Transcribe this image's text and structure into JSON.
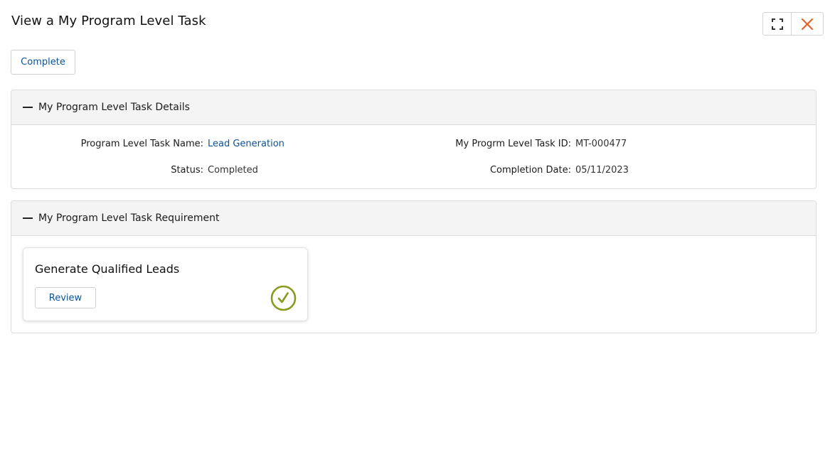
{
  "window": {
    "title": "View a My Program Level Task",
    "expand_icon": "expand-icon",
    "close_icon": "close-icon",
    "close_color": "#e8632b"
  },
  "toolbar": {
    "complete_label": "Complete"
  },
  "details_panel": {
    "title": "My Program Level Task Details",
    "fields": {
      "task_name_label": "Program Level Task Name:",
      "task_name_value": "Lead Generation",
      "task_id_label": "My Progrm Level Task ID:",
      "task_id_value": "MT-000477",
      "status_label": "Status:",
      "status_value": "Completed",
      "completion_date_label": "Completion Date:",
      "completion_date_value": "05/11/2023"
    }
  },
  "requirement_panel": {
    "title": "My Program Level Task Requirement",
    "card": {
      "title": "Generate Qualified Leads",
      "review_label": "Review",
      "status_icon": "check-circle-icon",
      "status_color": "#8a9a1e"
    }
  },
  "colors": {
    "link": "#0b5394",
    "panel_header_bg": "#f4f4f4",
    "border": "#dcdcdc"
  }
}
